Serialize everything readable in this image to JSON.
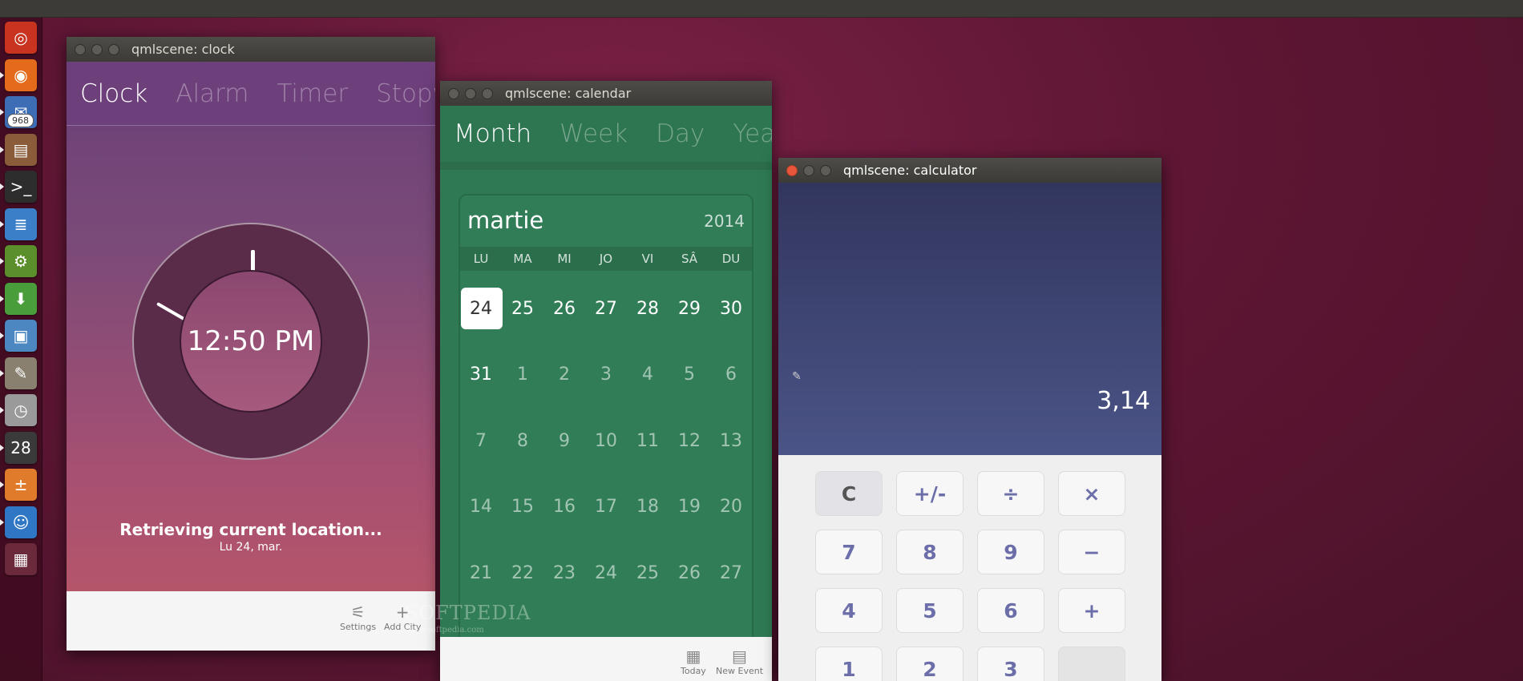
{
  "launcher": {
    "badge": "968",
    "items": [
      {
        "name": "ubuntu-dash-icon",
        "color": "#c8341f",
        "glyph": "◎"
      },
      {
        "name": "firefox-icon",
        "color": "#e46b1b",
        "glyph": "◉"
      },
      {
        "name": "thunderbird-icon",
        "color": "#3c6db5",
        "glyph": "✉"
      },
      {
        "name": "files-icon",
        "color": "#8a5c3a",
        "glyph": "▤"
      },
      {
        "name": "terminal-icon",
        "color": "#2d2d2d",
        "glyph": ">_"
      },
      {
        "name": "writer-icon",
        "color": "#3a7fc7",
        "glyph": "≣"
      },
      {
        "name": "settings-eye-icon",
        "color": "#5a8f2c",
        "glyph": "⚙"
      },
      {
        "name": "download-icon",
        "color": "#4a9d3b",
        "glyph": "⬇"
      },
      {
        "name": "monitor-icon",
        "color": "#4d87c2",
        "glyph": "▣"
      },
      {
        "name": "gimp-icon",
        "color": "#8a8070",
        "glyph": "✎"
      },
      {
        "name": "clock-app-icon",
        "color": "#9a9a9a",
        "glyph": "◷"
      },
      {
        "name": "calendar-app-icon",
        "color": "#3a3a3a",
        "glyph": "28"
      },
      {
        "name": "calculator-app-icon",
        "color": "#e07b2c",
        "glyph": "±"
      },
      {
        "name": "messaging-icon",
        "color": "#2f76c4",
        "glyph": "☺"
      },
      {
        "name": "workspace-switcher-icon",
        "color": "#6b2a3c",
        "glyph": "▦"
      }
    ]
  },
  "clock": {
    "title": "qmlscene: clock",
    "tabs": [
      "Clock",
      "Alarm",
      "Timer",
      "Stopwa"
    ],
    "time": "12:50 PM",
    "location": "Retrieving current location...",
    "date": "Lu 24, mar.",
    "bottom": {
      "settings": "Settings",
      "add_city": "Add City"
    }
  },
  "calendar": {
    "title": "qmlscene: calendar",
    "tabs": [
      "Month",
      "Week",
      "Day",
      "Year"
    ],
    "month": "martie",
    "year": "2014",
    "dow": [
      "LU",
      "MA",
      "MI",
      "JO",
      "VI",
      "SÂ",
      "DU"
    ],
    "weeks": [
      [
        "24",
        "25",
        "26",
        "27",
        "28",
        "29",
        "30"
      ],
      [
        "31",
        "1",
        "2",
        "3",
        "4",
        "5",
        "6"
      ],
      [
        "7",
        "8",
        "9",
        "10",
        "11",
        "12",
        "13"
      ],
      [
        "14",
        "15",
        "16",
        "17",
        "18",
        "19",
        "20"
      ],
      [
        "21",
        "22",
        "23",
        "24",
        "25",
        "26",
        "27"
      ]
    ],
    "bottom": {
      "today": "Today",
      "new_event": "New Event"
    }
  },
  "calculator": {
    "title": "qmlscene: calculator",
    "display": "3,14",
    "keys": [
      [
        "C",
        "+/-",
        "÷",
        "×"
      ],
      [
        "7",
        "8",
        "9",
        "−"
      ],
      [
        "4",
        "5",
        "6",
        "+"
      ],
      [
        "1",
        "2",
        "3",
        ""
      ]
    ]
  },
  "watermark": {
    "brand": "SOFTPEDIA",
    "url": "www.softpedia.com"
  }
}
